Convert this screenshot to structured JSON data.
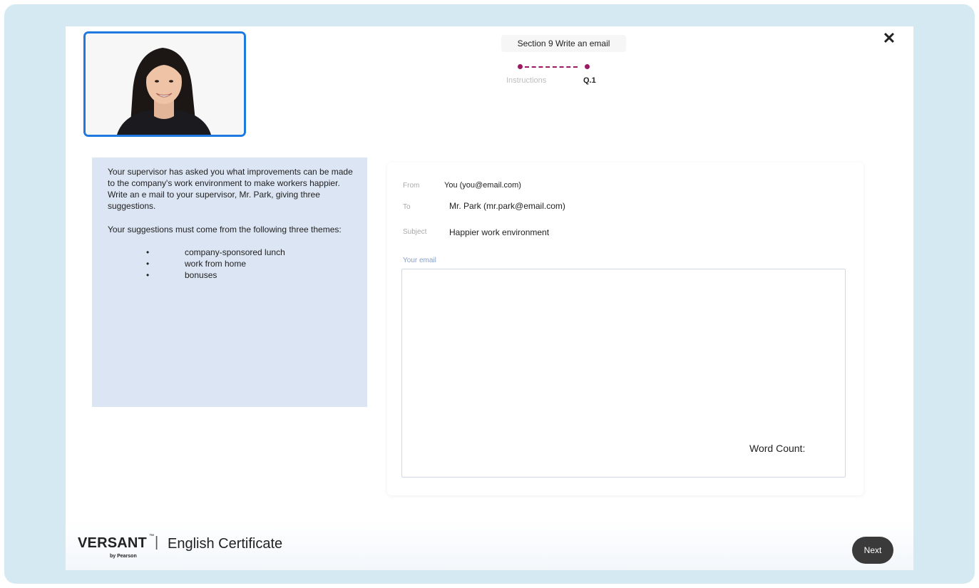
{
  "header": {
    "section_title": "Section 9  Write an email",
    "progress": {
      "steps": [
        "Instructions",
        "Q.1"
      ],
      "current_step": "Q.1"
    }
  },
  "prompt": {
    "paragraph1": "Your supervisor has asked you what improvements can be made to the company's work environment to make workers happier. Write an e mail to your supervisor, Mr. Park, giving three suggestions.",
    "paragraph2": "Your suggestions must come from the following three themes:",
    "themes": [
      "company-sponsored lunch",
      "work from home",
      "bonuses"
    ]
  },
  "email": {
    "from_label": "From",
    "from_value": "You (you@email.com)",
    "to_label": "To",
    "to_value": "Mr. Park (mr.park@email.com)",
    "subject_label": "Subject",
    "subject_value": "Happier work environment",
    "body_label": "Your email",
    "body_value": "",
    "word_count_label": "Word Count:"
  },
  "footer": {
    "brand": "VERSANT",
    "brand_tm": "™",
    "brand_separator": "|",
    "product": "English Certificate",
    "brand_sub": "by Pearson",
    "next_label": "Next"
  },
  "icons": {
    "close": "close-icon",
    "bullet": "bullet-icon"
  },
  "colors": {
    "accent_progress": "#9c1a62",
    "video_border": "#1f7ae0",
    "prompt_bg": "#dce5f3",
    "frame_bg": "#d5e9f2",
    "next_button_bg": "#3a3a3a"
  }
}
